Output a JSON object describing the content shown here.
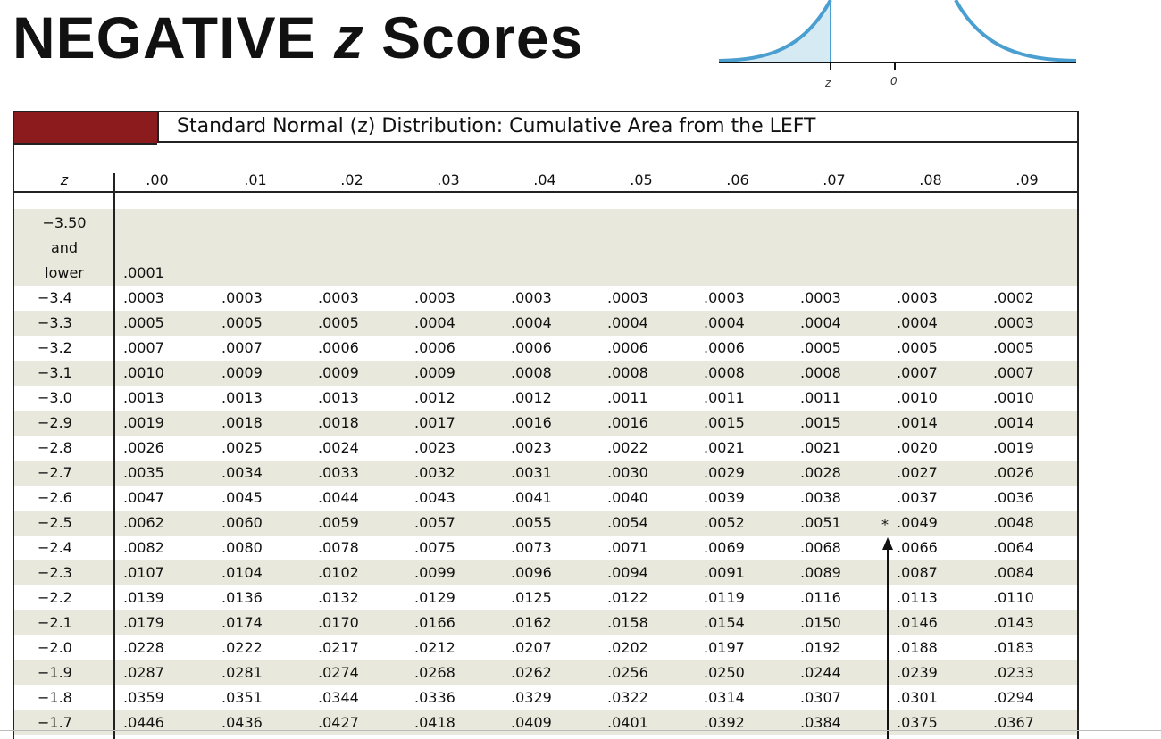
{
  "title": {
    "prefix": "NEGATIVE ",
    "z": "z",
    "suffix": " Scores"
  },
  "curve": {
    "z_label": "z",
    "zero_label": "0",
    "line_color": "#4a9fd0",
    "fill_color": "#d6eaf4"
  },
  "table": {
    "accent_color": "#8b1b1d",
    "band_color": "#e9e8dc",
    "heading": "Standard Normal (z) Distribution: Cumulative Area from the LEFT",
    "z_header": "z",
    "col_headers": [
      ".00",
      ".01",
      ".02",
      ".03",
      ".04",
      ".05",
      ".06",
      ".07",
      ".08",
      ".09"
    ],
    "first_row": {
      "z_lines": [
        "−3.50",
        "and",
        "lower"
      ],
      "value": ".0001"
    },
    "rows": [
      {
        "z": "−3.4",
        "values": [
          ".0003",
          ".0003",
          ".0003",
          ".0003",
          ".0003",
          ".0003",
          ".0003",
          ".0003",
          ".0003",
          ".0002"
        ]
      },
      {
        "z": "−3.3",
        "values": [
          ".0005",
          ".0005",
          ".0005",
          ".0004",
          ".0004",
          ".0004",
          ".0004",
          ".0004",
          ".0004",
          ".0003"
        ]
      },
      {
        "z": "−3.2",
        "values": [
          ".0007",
          ".0007",
          ".0006",
          ".0006",
          ".0006",
          ".0006",
          ".0006",
          ".0005",
          ".0005",
          ".0005"
        ]
      },
      {
        "z": "−3.1",
        "values": [
          ".0010",
          ".0009",
          ".0009",
          ".0009",
          ".0008",
          ".0008",
          ".0008",
          ".0008",
          ".0007",
          ".0007"
        ]
      },
      {
        "z": "−3.0",
        "values": [
          ".0013",
          ".0013",
          ".0013",
          ".0012",
          ".0012",
          ".0011",
          ".0011",
          ".0011",
          ".0010",
          ".0010"
        ]
      },
      {
        "z": "−2.9",
        "values": [
          ".0019",
          ".0018",
          ".0018",
          ".0017",
          ".0016",
          ".0016",
          ".0015",
          ".0015",
          ".0014",
          ".0014"
        ]
      },
      {
        "z": "−2.8",
        "values": [
          ".0026",
          ".0025",
          ".0024",
          ".0023",
          ".0023",
          ".0022",
          ".0021",
          ".0021",
          ".0020",
          ".0019"
        ]
      },
      {
        "z": "−2.7",
        "values": [
          ".0035",
          ".0034",
          ".0033",
          ".0032",
          ".0031",
          ".0030",
          ".0029",
          ".0028",
          ".0027",
          ".0026"
        ]
      },
      {
        "z": "−2.6",
        "values": [
          ".0047",
          ".0045",
          ".0044",
          ".0043",
          ".0041",
          ".0040",
          ".0039",
          ".0038",
          ".0037",
          ".0036"
        ]
      },
      {
        "z": "−2.5",
        "values": [
          ".0062",
          ".0060",
          ".0059",
          ".0057",
          ".0055",
          ".0054",
          ".0052",
          ".0051",
          ".0049",
          ".0048"
        ]
      },
      {
        "z": "−2.4",
        "values": [
          ".0082",
          ".0080",
          ".0078",
          ".0075",
          ".0073",
          ".0071",
          ".0069",
          ".0068",
          ".0066",
          ".0064"
        ]
      },
      {
        "z": "−2.3",
        "values": [
          ".0107",
          ".0104",
          ".0102",
          ".0099",
          ".0096",
          ".0094",
          ".0091",
          ".0089",
          ".0087",
          ".0084"
        ]
      },
      {
        "z": "−2.2",
        "values": [
          ".0139",
          ".0136",
          ".0132",
          ".0129",
          ".0125",
          ".0122",
          ".0119",
          ".0116",
          ".0113",
          ".0110"
        ]
      },
      {
        "z": "−2.1",
        "values": [
          ".0179",
          ".0174",
          ".0170",
          ".0166",
          ".0162",
          ".0158",
          ".0154",
          ".0150",
          ".0146",
          ".0143"
        ]
      },
      {
        "z": "−2.0",
        "values": [
          ".0228",
          ".0222",
          ".0217",
          ".0212",
          ".0207",
          ".0202",
          ".0197",
          ".0192",
          ".0188",
          ".0183"
        ]
      },
      {
        "z": "−1.9",
        "values": [
          ".0287",
          ".0281",
          ".0274",
          ".0268",
          ".0262",
          ".0256",
          ".0250",
          ".0244",
          ".0239",
          ".0233"
        ]
      },
      {
        "z": "−1.8",
        "values": [
          ".0359",
          ".0351",
          ".0344",
          ".0336",
          ".0329",
          ".0322",
          ".0314",
          ".0307",
          ".0301",
          ".0294"
        ]
      },
      {
        "z": "−1.7",
        "values": [
          ".0446",
          ".0436",
          ".0427",
          ".0418",
          ".0409",
          ".0401",
          ".0392",
          ".0384",
          ".0375",
          ".0367"
        ]
      }
    ],
    "star_marker": "*"
  }
}
